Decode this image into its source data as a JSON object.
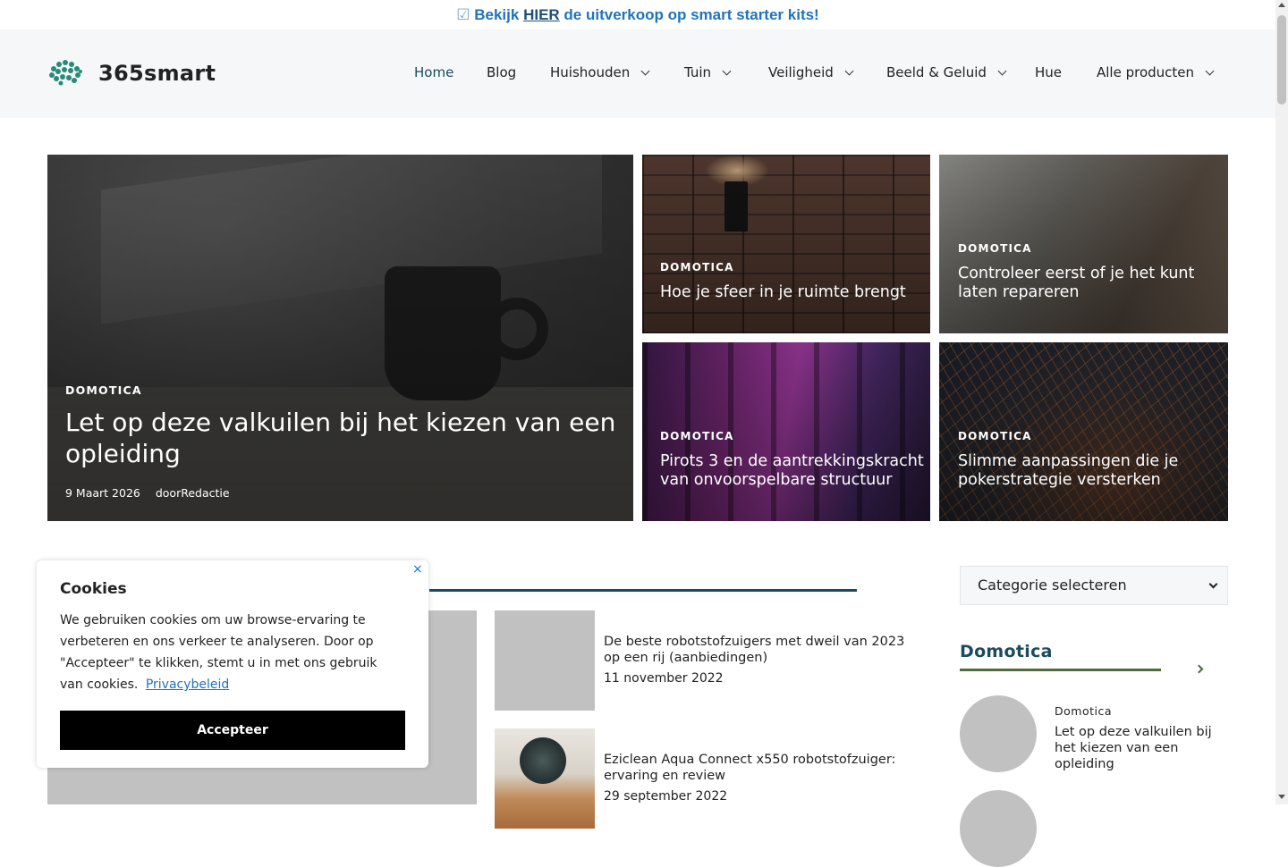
{
  "topbar": {
    "check": "☑",
    "before": "Bekijk",
    "link": "HIER",
    "after": "de uitverkoop op smart starter kits!"
  },
  "header": {
    "brand": "365smart",
    "nav": [
      {
        "label": "Home",
        "dropdown": false,
        "active": true
      },
      {
        "label": "Blog",
        "dropdown": false
      },
      {
        "label": "Huishouden",
        "dropdown": true
      },
      {
        "label": "Tuin",
        "dropdown": true
      },
      {
        "label": "Veiligheid",
        "dropdown": true
      },
      {
        "label": "Beeld & Geluid",
        "dropdown": true
      },
      {
        "label": "Hue",
        "dropdown": false
      },
      {
        "label": "Alle producten",
        "dropdown": true
      }
    ]
  },
  "hero": {
    "main": {
      "category": "DOMOTICA",
      "title": "Let op deze valkuilen bij het kiezen van een opleiding",
      "date": "9 Maart 2026",
      "author": "doorRedactie"
    },
    "cards": [
      {
        "category": "DOMOTICA",
        "title": "Hoe je sfeer in je ruimte brengt"
      },
      {
        "category": "DOMOTICA",
        "title": "Controleer eerst of je het kunt laten repareren"
      },
      {
        "category": "DOMOTICA",
        "title": "Pirots 3 en de aantrekkingskracht van onvoorspelbare structuur"
      },
      {
        "category": "DOMOTICA",
        "title": "Slimme aanpassingen die je pokerstrategie versterken"
      }
    ]
  },
  "posts": [
    {
      "title": "De beste robotstofzuigers met dweil van 2023 op een rij (aanbiedingen)",
      "date": "11 november 2022"
    },
    {
      "title": "Eziclean Aqua Connect x550 robotstofzuiger: ervaring en review",
      "date": "29 september 2022"
    }
  ],
  "sidebar": {
    "select_label": "Categorie selecteren",
    "heading": "Domotica",
    "items": [
      {
        "category": "Domotica",
        "title": "Let op deze valkuilen bij het kiezen van een opleiding"
      }
    ]
  },
  "cookie": {
    "close": "×",
    "title": "Cookies",
    "text": "We gebruiken cookies om uw browse-ervaring te verbeteren en ons verkeer te analyseren. Door op \"Accepteer\" te klikken, stemt u in met ons gebruik van cookies.",
    "policy": "Privacybeleid",
    "accept": "Accepteer"
  },
  "colors": {
    "accent": "#1b4b5e",
    "link": "#1e73be",
    "green": "#4e6b3a"
  }
}
